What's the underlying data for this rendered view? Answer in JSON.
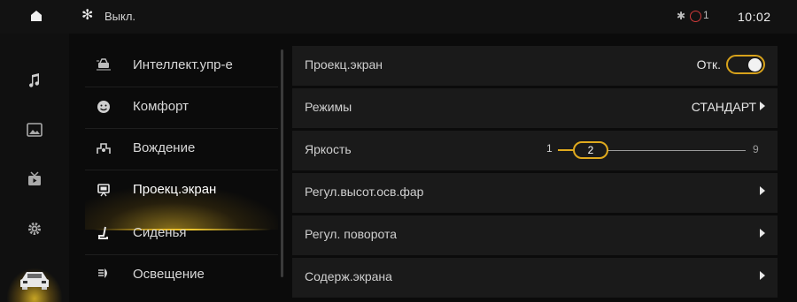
{
  "status_bar": {
    "fan_label": "Выкл.",
    "signal_text": "1",
    "time": "10:02"
  },
  "left_nav": {
    "items": [
      {
        "icon": "music-note-icon"
      },
      {
        "icon": "gallery-icon"
      },
      {
        "icon": "video-icon"
      },
      {
        "icon": "settings-gear-icon"
      },
      {
        "icon": "car-icon",
        "active": true
      }
    ]
  },
  "menu": {
    "items": [
      {
        "label": "Интеллект.упр-е",
        "icon": "intelligent-control-icon"
      },
      {
        "label": "Комфорт",
        "icon": "comfort-icon"
      },
      {
        "label": "Вождение",
        "icon": "driving-icon"
      },
      {
        "label": "Проекц.экран",
        "icon": "projection-screen-icon",
        "active": true
      },
      {
        "label": "Сиденья",
        "icon": "seat-icon"
      },
      {
        "label": "Освещение",
        "icon": "lighting-icon"
      }
    ]
  },
  "content": {
    "rows": [
      {
        "label": "Проекц.экран",
        "type": "toggle",
        "value": "Отк."
      },
      {
        "label": "Режимы",
        "type": "select",
        "value": "СТАНДАРТ"
      },
      {
        "label": "Яркость",
        "type": "slider",
        "min": "1",
        "max": "9",
        "value": "2"
      },
      {
        "label": "Регул.высот.осв.фар",
        "type": "link"
      },
      {
        "label": "Регул. поворота",
        "type": "link"
      },
      {
        "label": "Содерж.экрана",
        "type": "link"
      }
    ]
  },
  "colors": {
    "accent": "#e0aa1e",
    "background": "#0b0b0b",
    "row_background": "#1a1a1a",
    "status_red": "#d03a3a"
  }
}
